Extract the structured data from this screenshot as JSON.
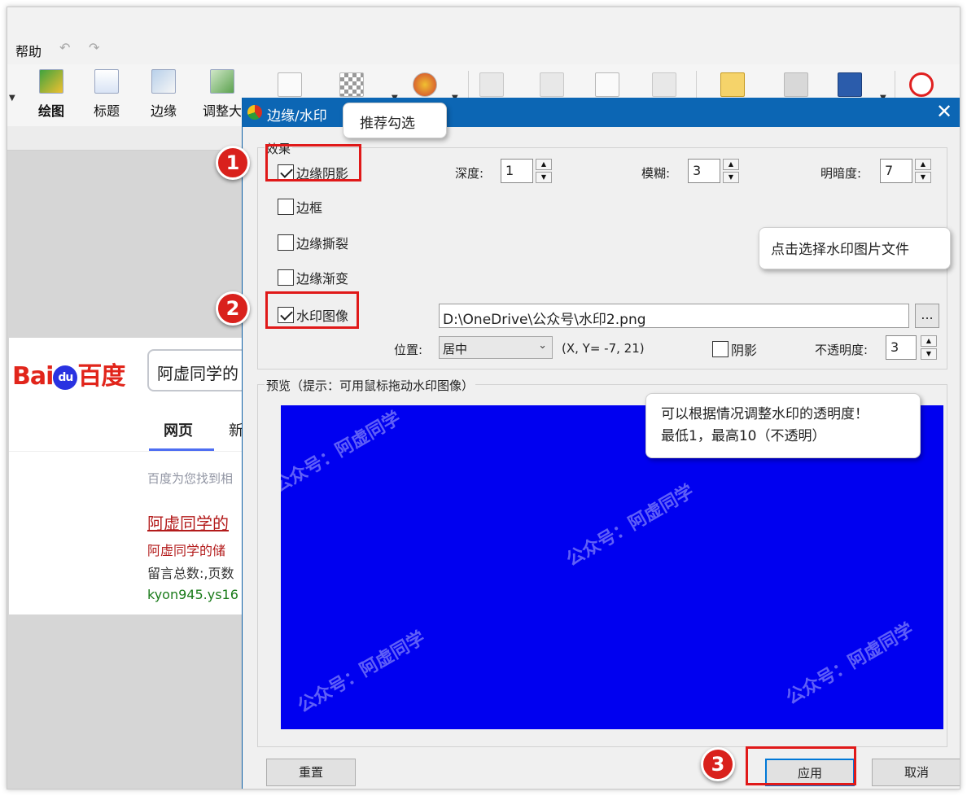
{
  "menubar": {
    "help": "帮助",
    "undo_icon": "undo-arrow",
    "redo_icon": "redo-arrow"
  },
  "toolbar": {
    "buttons": [
      {
        "label": "绘图",
        "icon": "draw-palette-icon"
      },
      {
        "label": "标题",
        "icon": "title-icon"
      },
      {
        "label": "边缘",
        "icon": "edge-icon"
      },
      {
        "label": "调整大",
        "icon": "resize-icon"
      }
    ]
  },
  "baidu": {
    "logo": "Bai",
    "logo_paw": "du",
    "logo_cn": "百度",
    "search_text": "阿虚同学的",
    "tab_web": "网页",
    "tab_news": "新",
    "hint": "百度为您找到相",
    "result_title": "阿虚同学的",
    "result_sub": "阿虚同学的储",
    "result_desc": "留言总数:,页数",
    "result_url": "kyon945.ys16"
  },
  "dialog": {
    "title": "边缘/水印",
    "effects_group": "效果",
    "checkboxes": {
      "edge_shadow": {
        "label": "边缘阴影",
        "checked": true
      },
      "border": {
        "label": "边框",
        "checked": false
      },
      "torn_edge": {
        "label": "边缘撕裂",
        "checked": false
      },
      "fade_edge": {
        "label": "边缘渐变",
        "checked": false
      },
      "watermark": {
        "label": "水印图像",
        "checked": true
      },
      "shadow": {
        "label": "阴影",
        "checked": false
      }
    },
    "depth": {
      "label": "深度:",
      "value": "1"
    },
    "blur": {
      "label": "模糊:",
      "value": "3"
    },
    "brightness": {
      "label": "明暗度:",
      "value": "7"
    },
    "watermark_path": "D:\\OneDrive\\公众号\\水印2.png",
    "browse_label": "...",
    "position": {
      "label": "位置:",
      "value": "居中",
      "coords": "(X, Y= -7, 21)"
    },
    "opacity": {
      "label": "不透明度:",
      "value": "3"
    },
    "preview_group": "预览（提示：可用鼠标拖动水印图像）",
    "watermark_text": "公众号：阿虚同学",
    "buttons": {
      "reset": "重置",
      "apply": "应用",
      "cancel": "取消"
    },
    "preview_color": "#0000f0"
  },
  "annotations": {
    "callout_recommend": "推荐勾选",
    "callout_file": "点击选择水印图片文件",
    "callout_opacity_line1": "可以根据情况调整水印的透明度！",
    "callout_opacity_line2": "最低1，最高10（不透明）",
    "marker_1": "1",
    "marker_2": "2",
    "marker_3": "3",
    "highlight_color": "#e01919"
  }
}
